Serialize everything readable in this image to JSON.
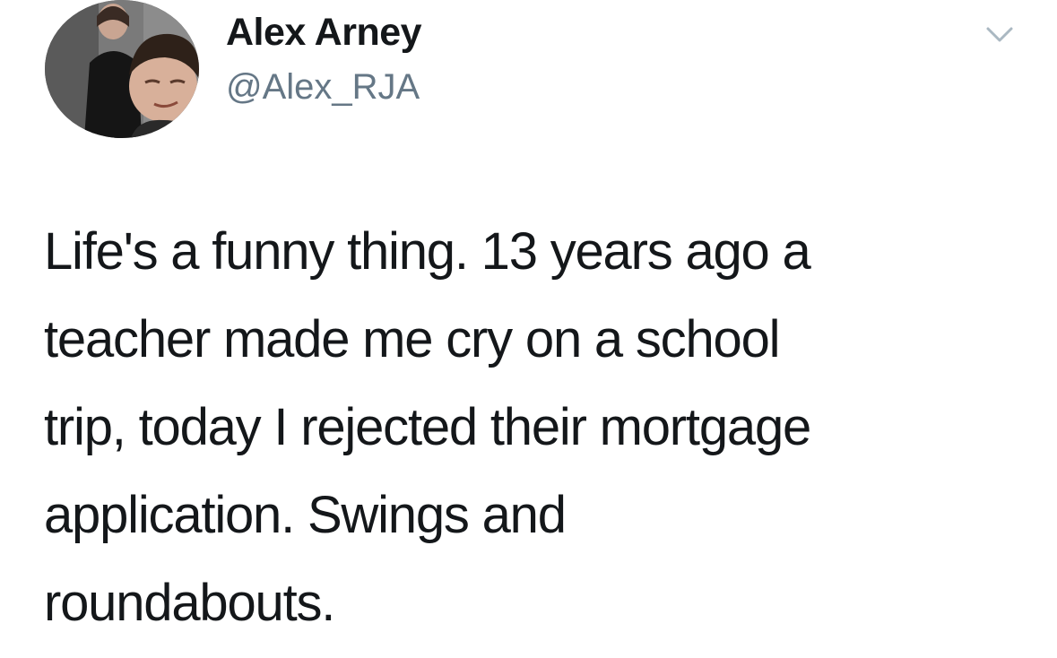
{
  "author": {
    "display_name": "Alex Arney",
    "handle": "@Alex_RJA"
  },
  "tweet": {
    "text": "Life's a funny thing. 13 years ago a\nteacher made me cry on a school\ntrip, today I rejected their mortgage\napplication. Swings and\nroundabouts."
  },
  "icons": {
    "menu": "chevron-down-icon"
  },
  "colors": {
    "text_primary": "#14171a",
    "text_secondary": "#657786",
    "background": "#ffffff"
  }
}
